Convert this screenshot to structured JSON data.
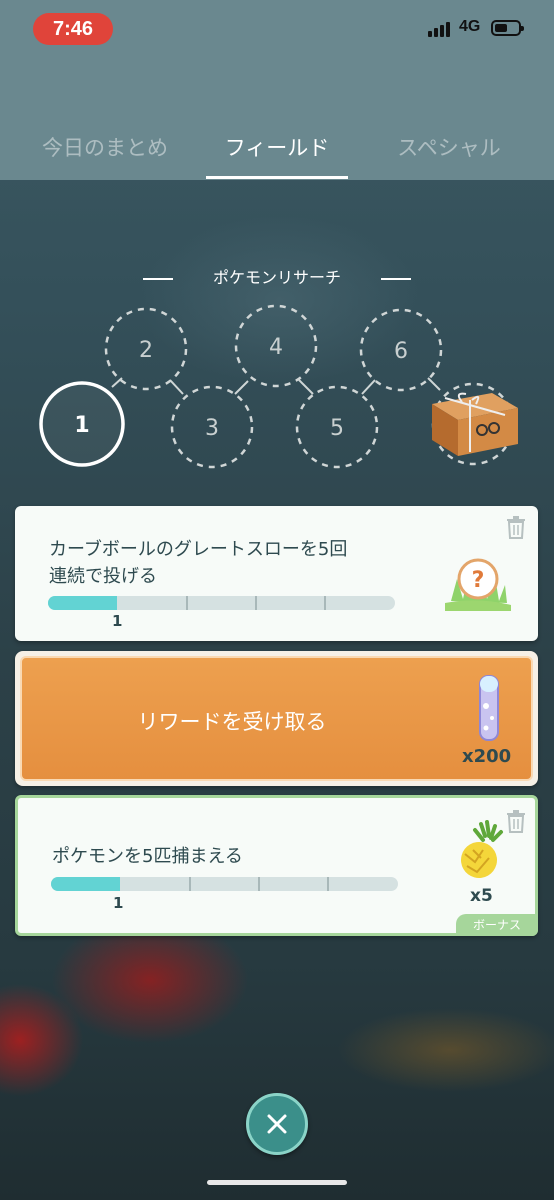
{
  "status_bar": {
    "time": "7:46",
    "network": "4G"
  },
  "tabs": [
    {
      "label": "今日のまとめ",
      "active": false
    },
    {
      "label": "フィールド",
      "active": true
    },
    {
      "label": "スペシャル",
      "active": false
    }
  ],
  "research": {
    "title": "ポケモンリサーチ",
    "steps": [
      "1",
      "2",
      "3",
      "4",
      "5",
      "6"
    ],
    "current_step": "1",
    "final_reward_icon": "box-reward-icon"
  },
  "tasks": [
    {
      "text_line1": "カーブボールのグレートスローを5回",
      "text_line2": "連続で投げる",
      "progress": 1,
      "goal": 5,
      "progress_label": "1",
      "reward_icon": "mystery-encounter-icon"
    },
    {
      "text": "ポケモンを5匹捕まえる",
      "progress": 1,
      "goal": 5,
      "progress_label": "1",
      "reward_icon": "golden-pinap-berry-icon",
      "reward_count": "x5",
      "bonus_label": "ボーナス"
    }
  ],
  "claim_reward": {
    "label": "リワードを受け取る",
    "reward_icon": "stardust-icon",
    "reward_count": "x200"
  },
  "colors": {
    "header": "#6a888f",
    "progress_fill": "#62d3d3",
    "reward_orange": "#e58f3f",
    "bonus_green": "#a6d69b",
    "time_pill": "#e0443a"
  }
}
